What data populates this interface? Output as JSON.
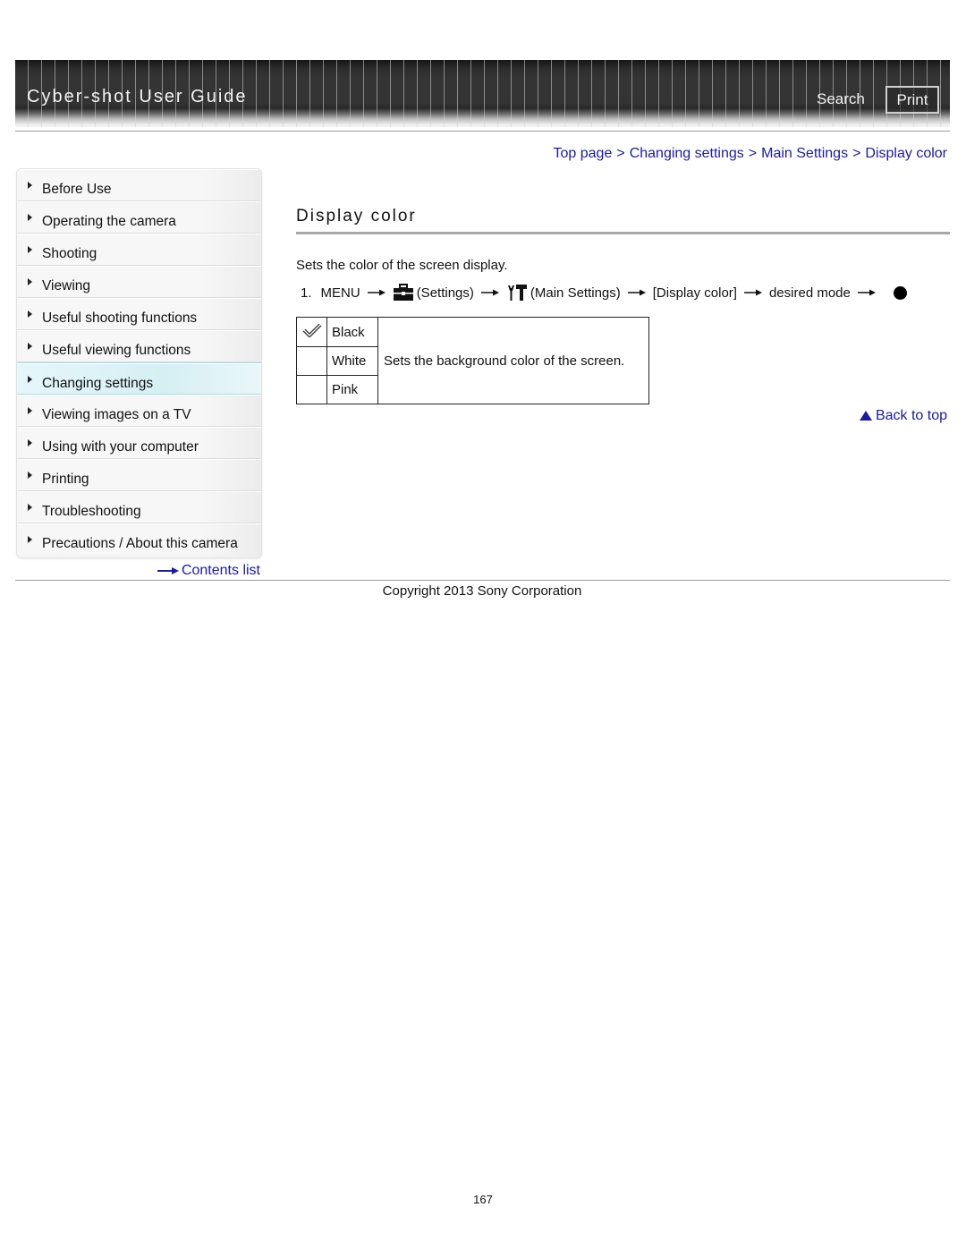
{
  "header": {
    "title": "Cyber-shot User Guide",
    "search_label": "Search",
    "print_label": "Print"
  },
  "breadcrumb": [
    {
      "label": "Top page"
    },
    {
      "label": "Changing settings"
    },
    {
      "label": "Main Settings"
    },
    {
      "label": "Display color"
    }
  ],
  "breadcrumb_separator": ">",
  "sidebar": {
    "items": [
      {
        "label": "Before Use",
        "active": false
      },
      {
        "label": "Operating the camera",
        "active": false
      },
      {
        "label": "Shooting",
        "active": false
      },
      {
        "label": "Viewing",
        "active": false
      },
      {
        "label": "Useful shooting functions",
        "active": false
      },
      {
        "label": "Useful viewing functions",
        "active": false
      },
      {
        "label": "Changing settings",
        "active": true
      },
      {
        "label": "Viewing images on a TV",
        "active": false
      },
      {
        "label": "Using with your computer",
        "active": false
      },
      {
        "label": "Printing",
        "active": false
      },
      {
        "label": "Troubleshooting",
        "active": false
      },
      {
        "label": "Precautions / About this camera",
        "active": false
      }
    ],
    "contents_list_label": "Contents list"
  },
  "main": {
    "title": "Display color",
    "description": "Sets the color of the screen display.",
    "step": {
      "number": "1.",
      "menu": "MENU",
      "settings_icon": "toolbox-icon",
      "settings_label": "(Settings)",
      "main_settings_icon": "wrench-hammer-icon",
      "main_settings_label": "(Main Settings)",
      "display_color": "[Display color]",
      "desired_mode": "desired mode",
      "confirm_icon": "center-button-icon"
    },
    "options": [
      {
        "name": "Black",
        "default": true
      },
      {
        "name": "White",
        "default": false
      },
      {
        "name": "Pink",
        "default": false
      }
    ],
    "options_description": "Sets the background color of the screen.",
    "back_to_top": "Back to top"
  },
  "footer": {
    "copyright": "Copyright 2013 Sony Corporation",
    "page_number": "167"
  },
  "colors": {
    "link": "#1a1aa6",
    "active_nav_bg": "#d5eff3",
    "active_nav_border": "#9fe0ea",
    "banner_bg": "#343434"
  }
}
